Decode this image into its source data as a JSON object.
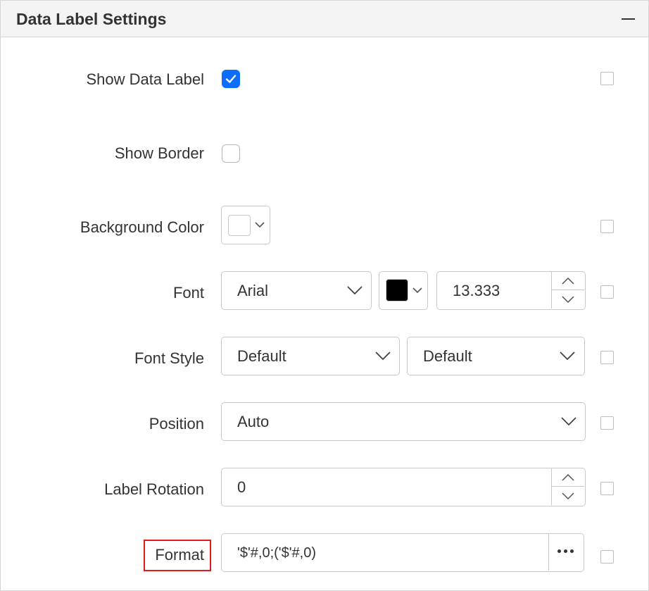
{
  "panel": {
    "title": "Data Label Settings"
  },
  "rows": {
    "show_data_label": {
      "label": "Show Data Label",
      "checked": true
    },
    "show_border": {
      "label": "Show Border",
      "checked": false
    },
    "background_color": {
      "label": "Background Color",
      "color": "#ffffff"
    },
    "font": {
      "label": "Font",
      "family": "Arial",
      "color": "#000000",
      "size": "13.333"
    },
    "font_style": {
      "label": "Font Style",
      "style": "Default",
      "weight": "Default"
    },
    "position": {
      "label": "Position",
      "value": "Auto"
    },
    "label_rotation": {
      "label": "Label Rotation",
      "value": "0"
    },
    "format": {
      "label": "Format",
      "value": "'$'#,0;('$'#,0)"
    }
  },
  "colors": {
    "accent": "#0d6efd",
    "highlight_border": "#e01b1b"
  }
}
